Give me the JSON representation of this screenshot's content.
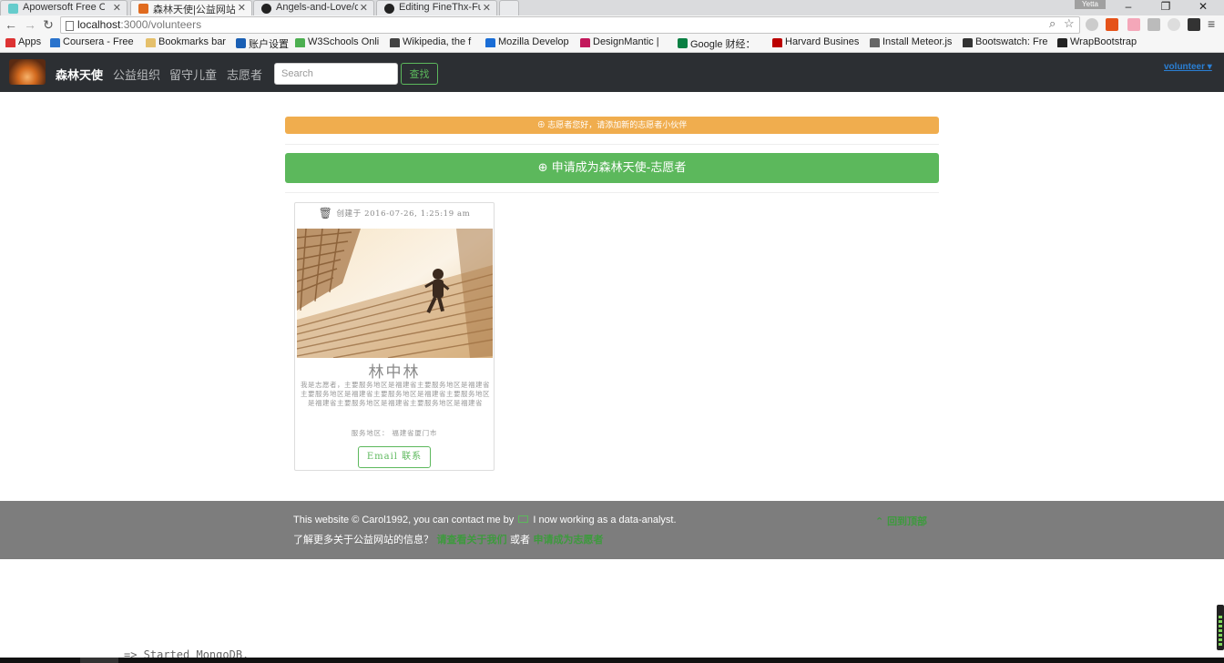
{
  "browser": {
    "tabs": [
      {
        "label": "Apowersoft Free O",
        "active": false
      },
      {
        "label": "森林天使|公益网站",
        "active": true
      },
      {
        "label": "Angels-and-Love/c",
        "active": false
      },
      {
        "label": "Editing FineThx-Fu",
        "active": false
      }
    ],
    "profile": "Yetta",
    "url_host": "localhost",
    "url_path": ":3000/volunteers",
    "bookmarks": [
      {
        "label": "Apps",
        "icon": "apps-grid-icon",
        "color": "#d33"
      },
      {
        "label": "Coursera - Free",
        "icon": "coursera-icon",
        "color": "#2a73cc"
      },
      {
        "label": "Bookmarks bar",
        "icon": "folder-icon",
        "color": "#e5c06b"
      },
      {
        "label": "账户设置",
        "icon": "tx-icon",
        "color": "#1a5fb4"
      },
      {
        "label": "W3Schools Onli",
        "icon": "w3schools-icon",
        "color": "#4caf50"
      },
      {
        "label": "Wikipedia, the f",
        "icon": "wikipedia-icon",
        "color": "#444"
      },
      {
        "label": "Mozilla Develop",
        "icon": "mozilla-icon",
        "color": "#1a6dd6"
      },
      {
        "label": "DesignMantic |",
        "icon": "designmantic-icon",
        "color": "#c2185b"
      },
      {
        "label": "Google 财经：",
        "icon": "google-finance-icon",
        "color": "#0a8043"
      },
      {
        "label": "Harvard Busines",
        "icon": "hbr-icon",
        "color": "#b00"
      },
      {
        "label": "Install Meteor.js",
        "icon": "meteor-icon",
        "color": "#666"
      },
      {
        "label": "Bootswatch: Fre",
        "icon": "bootswatch-icon",
        "color": "#333"
      },
      {
        "label": "WrapBootstrap",
        "icon": "wrapbootstrap-icon",
        "color": "#222"
      }
    ]
  },
  "navbar": {
    "brand": "森林天使",
    "links": [
      "公益组织",
      "留守儿童",
      "志愿者"
    ],
    "search_placeholder": "Search",
    "search_button": "查找",
    "user": "volunteer ▾"
  },
  "main": {
    "alert": "志愿者您好，请添加新的志愿者小伙伴",
    "apply_button": "申请成为森林天使-志愿者",
    "card": {
      "meta": "创建于 2016-07-26, 1:25:19 am",
      "name": "林中林",
      "description": "我是志愿者，主要服务地区是福建省主要服务地区是福建省主要服务地区是福建省主要服务地区是福建省主要服务地区是福建省主要服务地区是福建省主要服务地区是福建省",
      "area": "服务地区： 福建省厦门市",
      "email_button": "Email 联系"
    }
  },
  "footer": {
    "line1_prefix": "This website © Carol1992, you can contact me by",
    "line1_suffix": "I now working as a data-analyst.",
    "line2_prefix": "了解更多关于公益网站的信息？",
    "about_link": "请查看关于我们",
    "or_text": "或者",
    "volunteer_link": "申请成为志愿者",
    "back_to_top": "回到顶部"
  },
  "terminal_text": "=> Started MongoDB.",
  "colors": {
    "navbar": "#2c2f33",
    "success": "#5cb85c",
    "warning": "#f0ad4e",
    "footer": "#7d7d7d",
    "link": "#2a7fd4"
  }
}
